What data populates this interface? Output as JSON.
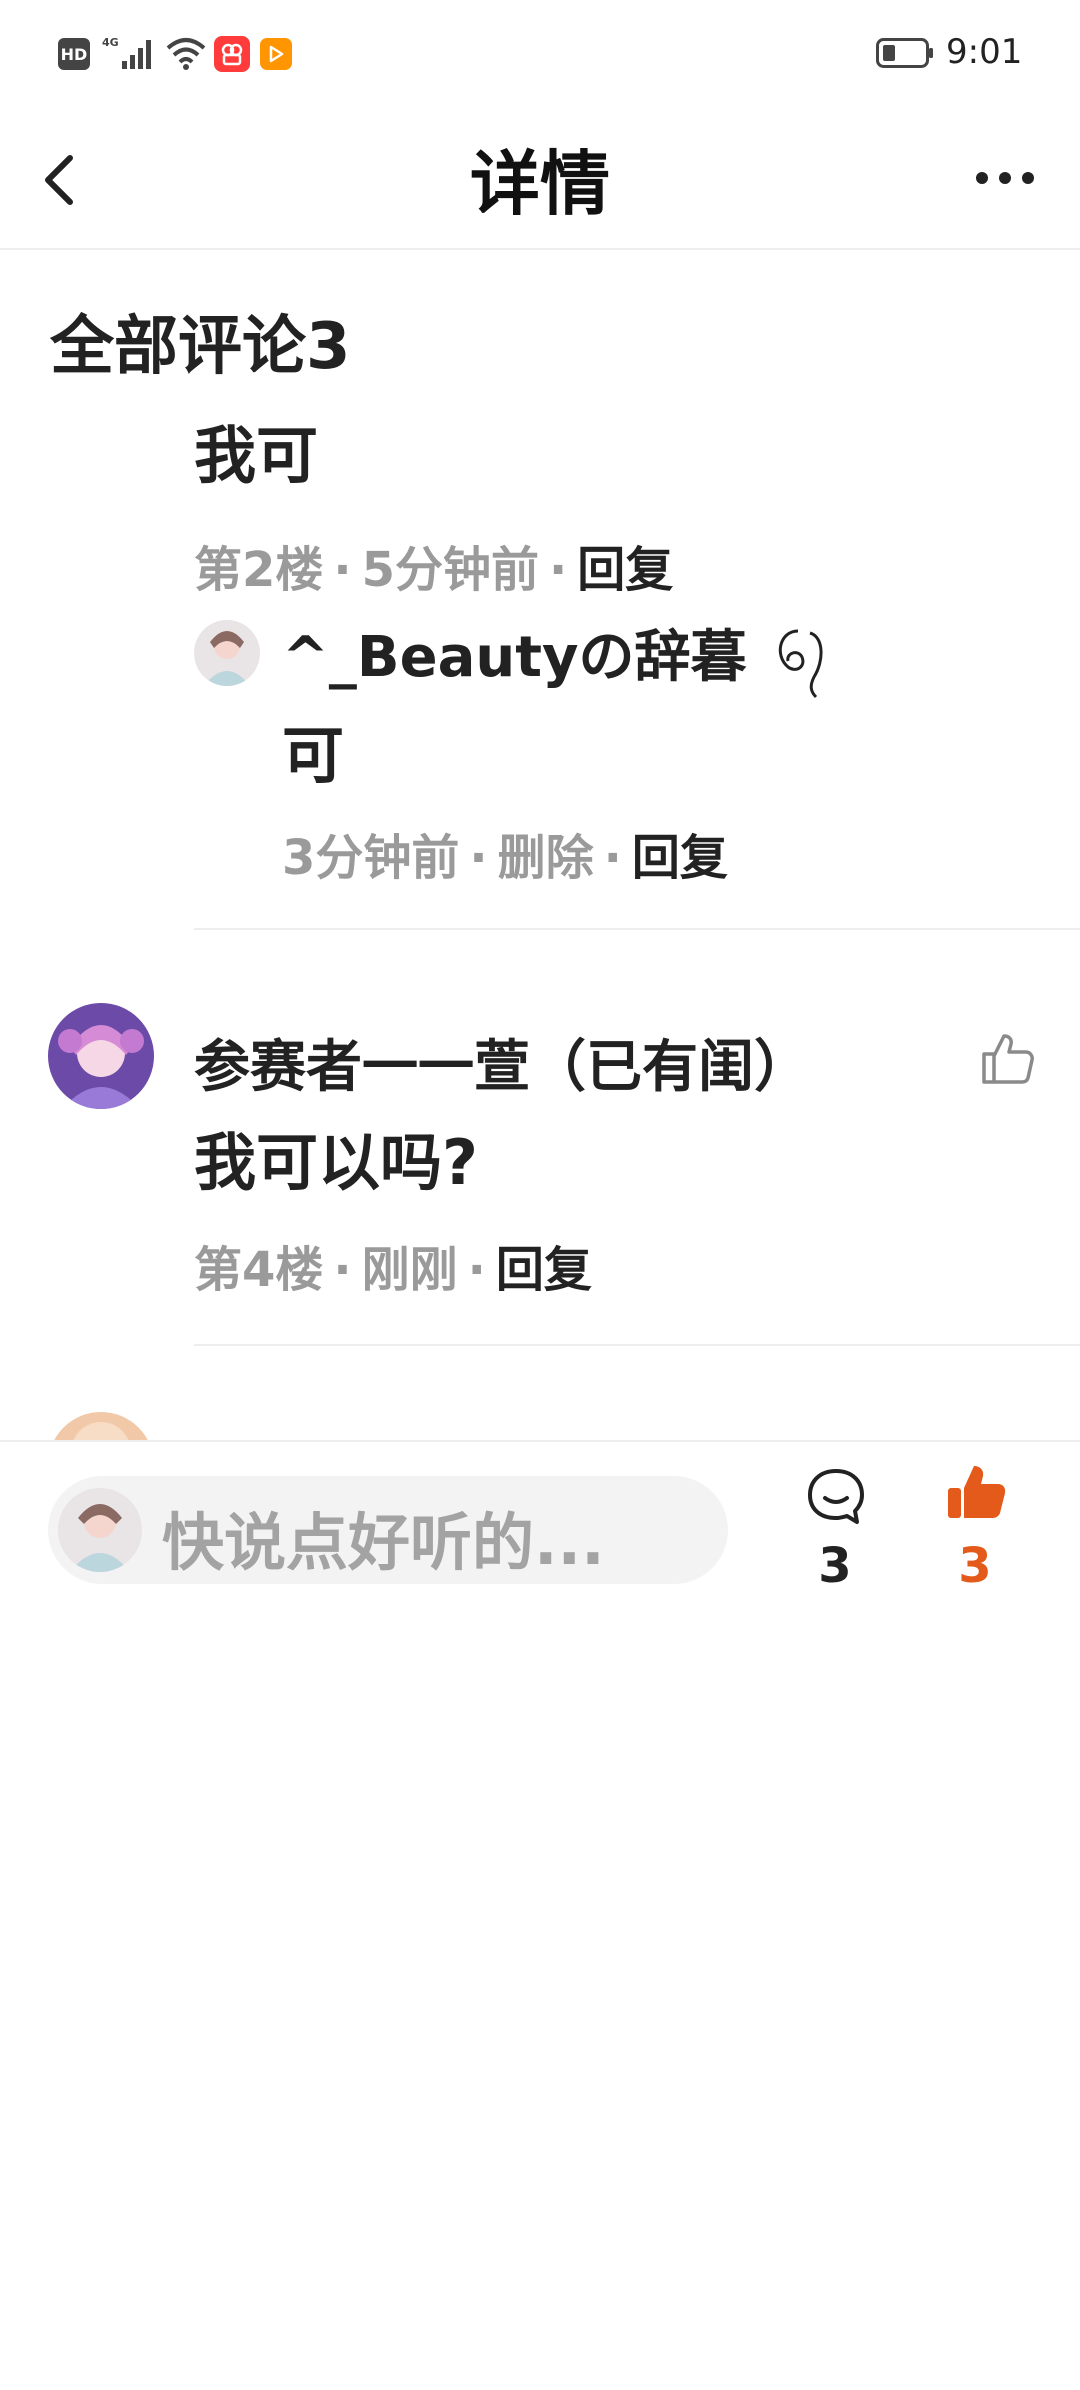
{
  "status_bar": {
    "hd": "HD",
    "network": "4G",
    "time": "9:01",
    "icons": [
      "hd-icon",
      "signal-icon",
      "wifi-icon",
      "app-notify-icon",
      "video-app-icon",
      "battery-icon"
    ]
  },
  "header": {
    "title": "详情",
    "back_icon": "chevron-left-icon",
    "more_icon": "more-dots-icon"
  },
  "comments_section": {
    "title": "全部评论3",
    "items": [
      {
        "text": "我可",
        "floor": "第2楼",
        "time": "5分钟前",
        "reply_label": "回复",
        "sub_reply": {
          "username": "^_Beautyの辞暮",
          "text": "可",
          "time": "3分钟前",
          "delete_label": "删除",
          "reply_label": "回复"
        }
      },
      {
        "username": "参赛者一一萱（已有闺）",
        "text": "我可以吗?",
        "floor": "第4楼",
        "time": "刚刚",
        "reply_label": "回复"
      }
    ]
  },
  "bottom_bar": {
    "input_placeholder": "快说点好听的...",
    "comment_count": "3",
    "like_count": "3",
    "accent_color": "#e35a1a"
  }
}
